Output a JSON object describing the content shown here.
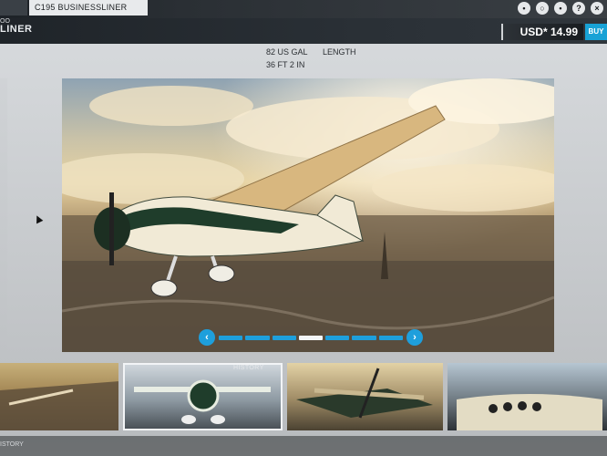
{
  "tabs": {
    "active_label": "C195 BUSINESSLINER"
  },
  "header": {
    "brand_line1": "OO",
    "brand_line2": "LINER",
    "price": "USD* 14.99",
    "buy_label": "BUY"
  },
  "top_icons": [
    {
      "name": "user-icon",
      "glyph": "•"
    },
    {
      "name": "search-icon",
      "glyph": "○"
    },
    {
      "name": "settings-icon",
      "glyph": "•"
    },
    {
      "name": "help-icon",
      "glyph": "?"
    },
    {
      "name": "close-icon",
      "glyph": "×"
    }
  ],
  "specs": {
    "fuel": "82 US GAL",
    "length_label": "LENGTH",
    "length_value": "36 FT 2 IN"
  },
  "carousel": {
    "prev_glyph": "‹",
    "next_glyph": "›",
    "slide_count": 7,
    "active_index": 3
  },
  "thumbnails": {
    "caption": "HISTORY",
    "footer_caption": "ISTORY"
  },
  "colors": {
    "accent": "#1e9fdc",
    "price_bg": "#181c20"
  }
}
